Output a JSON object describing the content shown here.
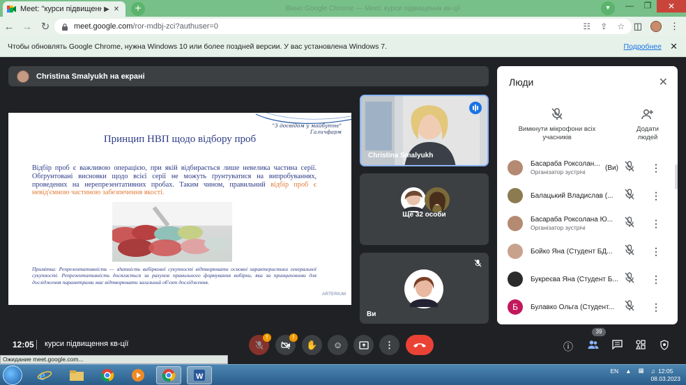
{
  "browser": {
    "tab_title": "Meet: \"курси підвищення к",
    "ghost_title": "Вікно Google Chrome — Meet: курси підвищення кв-ції",
    "new_tab": "+",
    "url_host": "meet.google.com",
    "url_path": "/ror-mdbj-zci?authuser=0",
    "infobar_text": "Чтобы обновлять Google Chrome, нужна Windows 10 или более поздней версии. У вас установлена Windows 7.",
    "infobar_more": "Подробнее"
  },
  "meet": {
    "presenter_label": "Christina Smalyukh на екрані",
    "slide": {
      "quote": "\"З досвідом у майбутнє\" Галичфарм",
      "title": "Принцип НВП щодо відбору проб",
      "body_main": "Відбір проб є важливою операцією, при якій відбирається лише невелика частина серії. Обґрунтовані висновки щодо всієї серії не можуть ґрунтуватися на випробуваннях, проведених на нерепрезентативних пробах. Таким чином, правильний ",
      "body_highlight": "відбір проб є невід'ємною частиною забезпечення якості.",
      "footnote": "Примітка: Репрезентативність — здатність вибіркової сукупності відтворювати основні характеристики генеральної сукупності. Репрезентативність досягається за рахунок правильного формування вибірки, яка за принциповими для дослідження параметрами має відтворювати загальний об'єкт дослідження.",
      "brand": "ARTERIUM"
    },
    "tiles": [
      {
        "name": "Christina Smalyukh"
      },
      {
        "name": "Ще 32 особи"
      },
      {
        "name": "Ви"
      }
    ],
    "people_panel": {
      "title": "Люди",
      "mute_all_label": "Вимкнути мікрофони всіх учасників",
      "add_people_label": "Додати людей",
      "participants": [
        {
          "name": "Басараба Роксолан...",
          "suffix": "(Ви)",
          "role": "Організатор зустрічі",
          "avatar_color": "#b58a72",
          "initial": ""
        },
        {
          "name": "Балацький Владислав (...",
          "suffix": "",
          "role": "",
          "avatar_color": "#8c7b50",
          "initial": ""
        },
        {
          "name": "Басараба Роксолана Ю...",
          "suffix": "",
          "role": "Організатор зустрічі",
          "avatar_color": "#b58a72",
          "initial": ""
        },
        {
          "name": "Бойко Яна (Студент БД...",
          "suffix": "",
          "role": "",
          "avatar_color": "#c9a28e",
          "initial": ""
        },
        {
          "name": "Букреєва Яна (Студент Б...",
          "suffix": "",
          "role": "",
          "avatar_color": "#2b2b2b",
          "initial": ""
        },
        {
          "name": "Булавко Ольга (Студент...",
          "suffix": "",
          "role": "",
          "avatar_color": "#c2185b",
          "initial": "Б"
        }
      ]
    },
    "controls": {
      "time": "12:05",
      "meeting_name": "курси підвищення кв-ції",
      "mic_badge": "!",
      "cam_badge": "!",
      "people_count": "39"
    }
  },
  "status_bar": "Ожидание meet.google.com...",
  "taskbar": {
    "lang": "EN",
    "time": "12:05",
    "date": "08.03.2023"
  }
}
